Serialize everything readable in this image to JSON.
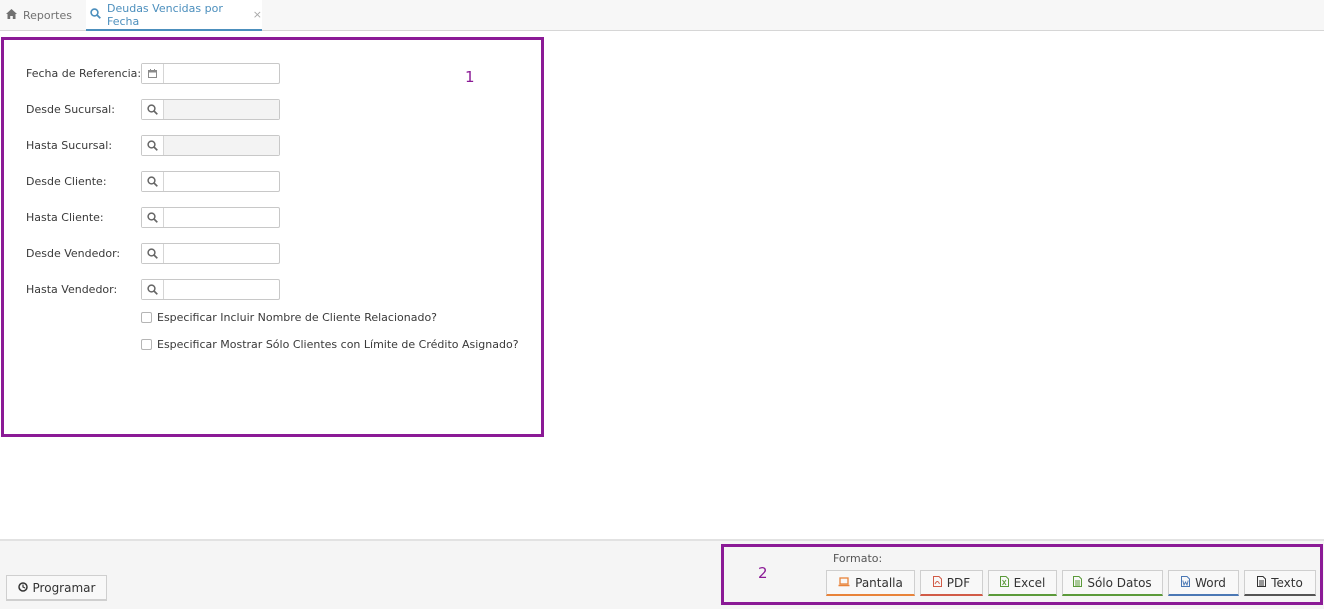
{
  "tabs": {
    "home": {
      "label": "Reportes",
      "icon": "home-icon"
    },
    "active": {
      "label": "Deudas Vencidas por Fecha",
      "icon": "search-icon",
      "close": "×"
    }
  },
  "annotations": {
    "box1": {
      "label": "1"
    },
    "box2": {
      "label": "2"
    },
    "color": "#8b1a96"
  },
  "form": {
    "fields": [
      {
        "label": "Fecha de Referencia:",
        "icon": "calendar-icon",
        "value": "",
        "readonly": false
      },
      {
        "label": "Desde Sucursal:",
        "icon": "search-icon",
        "value": "",
        "readonly": true
      },
      {
        "label": "Hasta Sucursal:",
        "icon": "search-icon",
        "value": "",
        "readonly": true
      },
      {
        "label": "Desde Cliente:",
        "icon": "search-icon",
        "value": "",
        "readonly": false
      },
      {
        "label": "Hasta Cliente:",
        "icon": "search-icon",
        "value": "",
        "readonly": false
      },
      {
        "label": "Desde Vendedor:",
        "icon": "search-icon",
        "value": "",
        "readonly": false
      },
      {
        "label": "Hasta Vendedor:",
        "icon": "search-icon",
        "value": "",
        "readonly": false
      }
    ],
    "checkboxes": [
      {
        "label": "Especificar Incluir Nombre de Cliente Relacionado?",
        "checked": false
      },
      {
        "label": "Especificar Mostrar Sólo Clientes con Límite de Crédito Asignado?",
        "checked": false
      }
    ]
  },
  "footer": {
    "programar": {
      "label": "Programar",
      "icon": "clock-icon"
    },
    "formato_label": "Formato:",
    "buttons": [
      {
        "label": "Pantalla",
        "icon": "laptop-icon",
        "accent": "#e8833a"
      },
      {
        "label": "PDF",
        "icon": "file-pdf-icon",
        "accent": "#d15b47"
      },
      {
        "label": "Excel",
        "icon": "file-excel-icon",
        "accent": "#5b9a3a"
      },
      {
        "label": "Sólo Datos",
        "icon": "file-text-icon",
        "accent": "#5b9a3a"
      },
      {
        "label": "Word",
        "icon": "file-word-icon",
        "accent": "#4a77b4"
      },
      {
        "label": "Texto",
        "icon": "file-text-icon",
        "accent": "#555555"
      }
    ]
  }
}
